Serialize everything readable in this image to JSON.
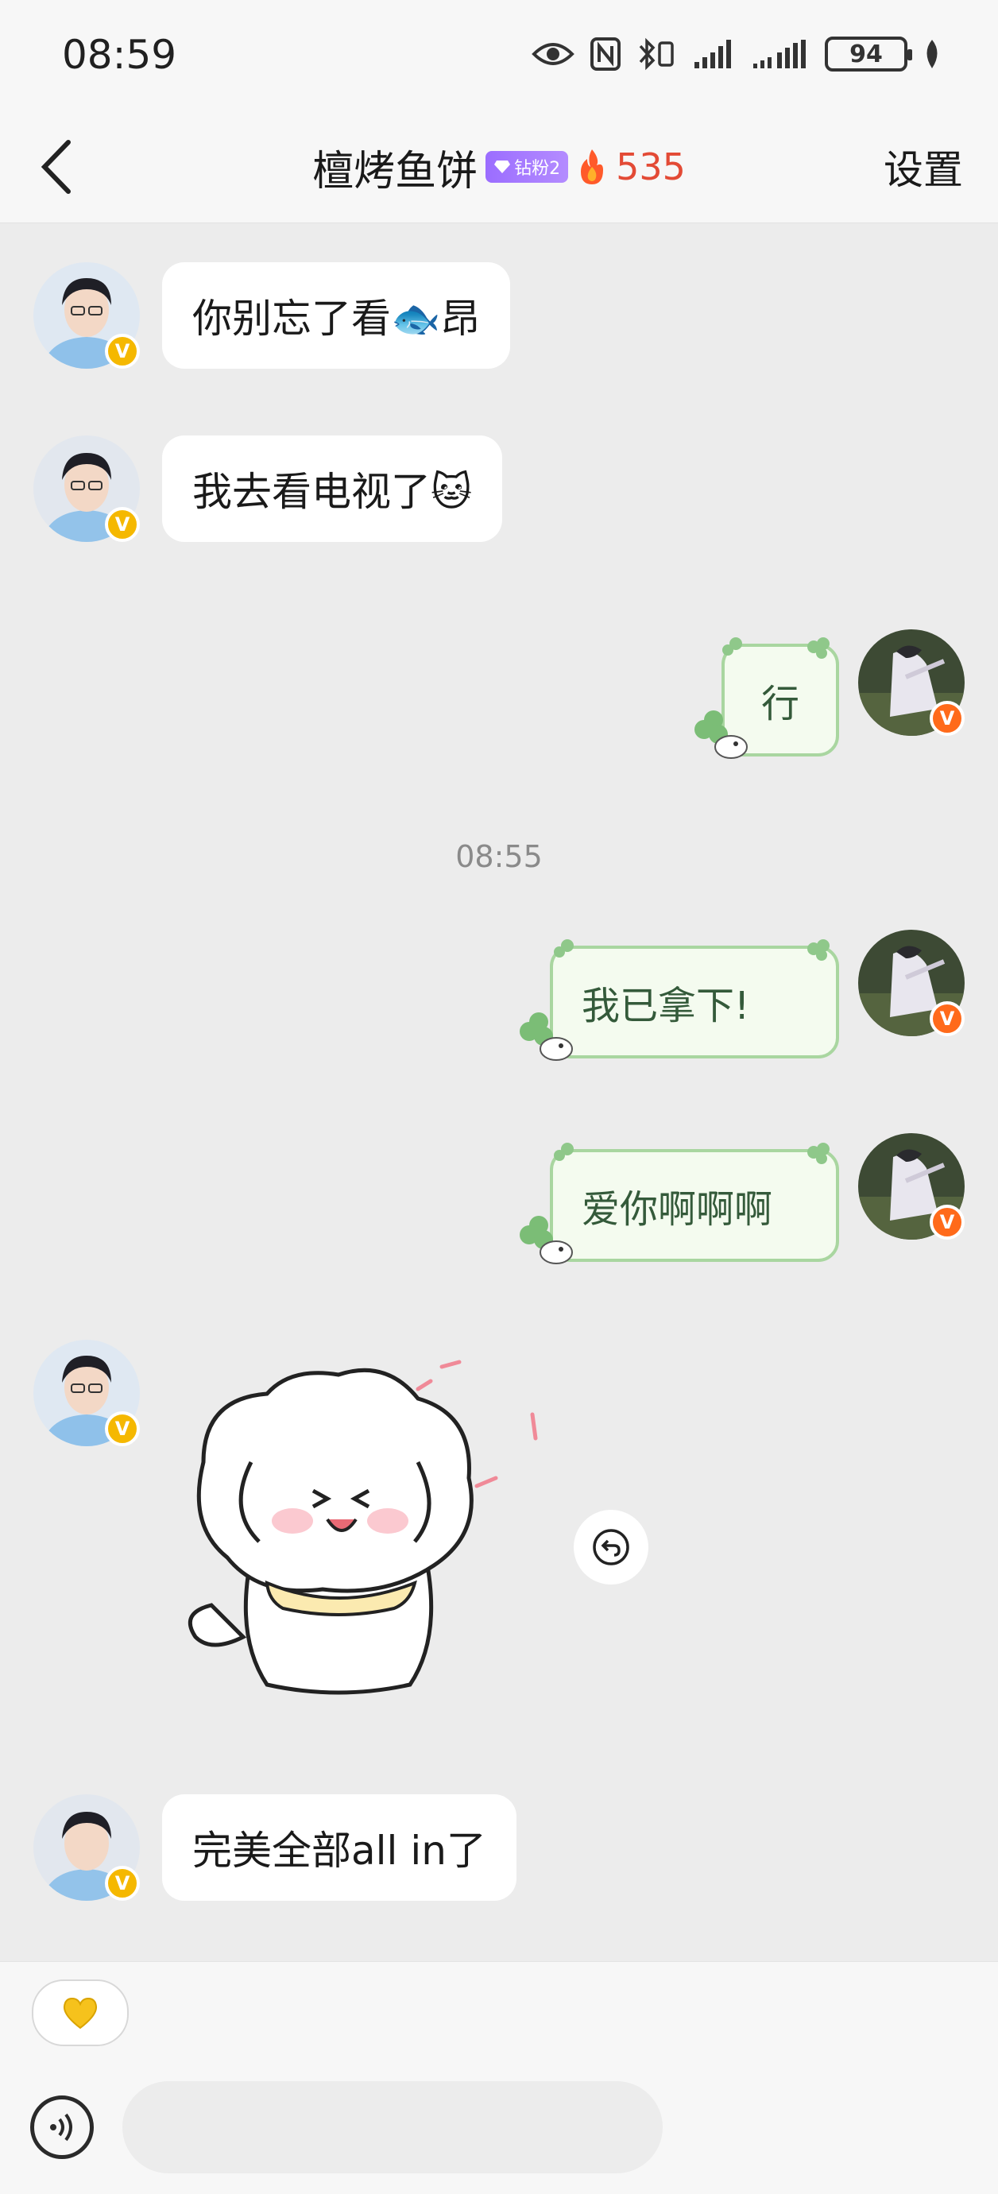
{
  "status_bar": {
    "time": "08:59",
    "battery": "94"
  },
  "nav": {
    "title": "檀烤鱼饼",
    "fan_badge": "钻粉2",
    "fire_count": "535",
    "settings_label": "设置"
  },
  "messages": {
    "m1": "你别忘了看🐟昂",
    "m2": "我去看电视了🐱",
    "m3": "行",
    "timestamp": "08:55",
    "m4": "我已拿下!",
    "m5": "爱你啊啊啊",
    "m7": "完美全部all in了"
  },
  "input": {
    "heart_icon": "yellow-heart",
    "placeholder": ""
  },
  "colors": {
    "background": "#ececec",
    "fire": "#e34a35",
    "badge_purple": "#9b6dff",
    "bubble_green_border": "#a9d6a0",
    "verified_gold": "#f5b800",
    "verified_orange": "#ff6a1a"
  }
}
